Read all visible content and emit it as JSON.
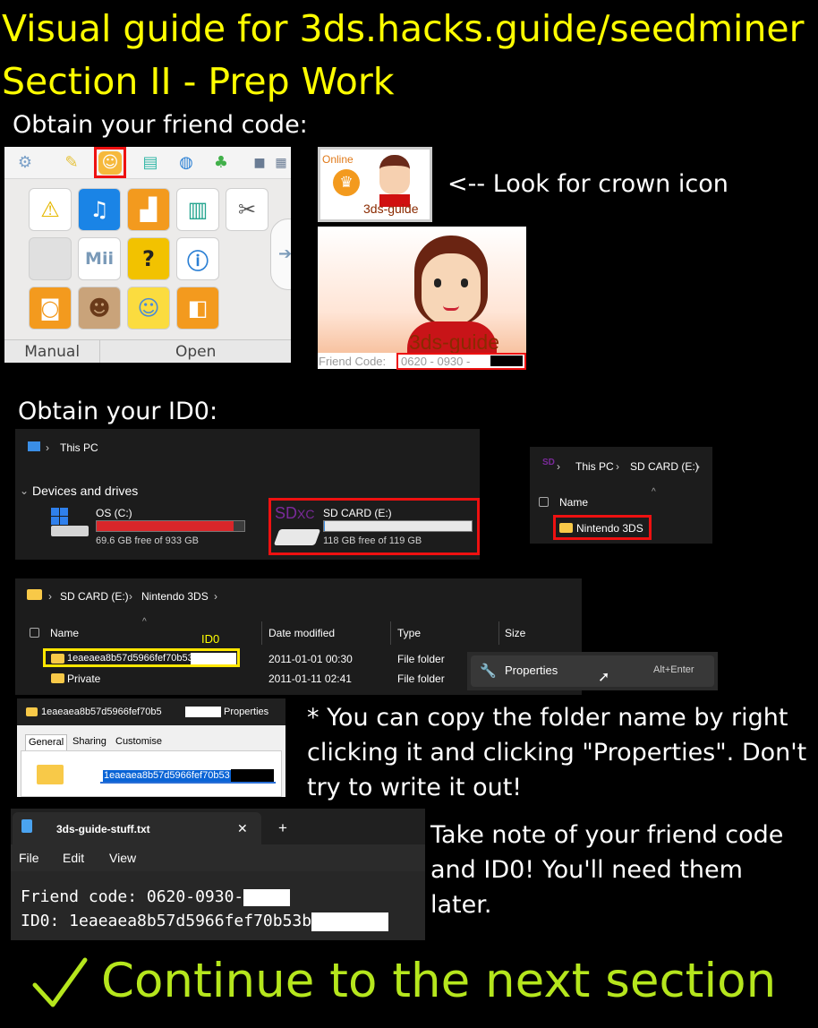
{
  "title_line1": "Visual guide for 3ds.hacks.guide/seedminer",
  "title_line2": "Section II - Prep Work",
  "step1_heading": "Obtain your friend  code:",
  "home_menu": {
    "manual": "Manual",
    "open": "Open",
    "mii_tile_text": "Mii"
  },
  "mii_small": {
    "status": "Online",
    "name": "3ds-guide"
  },
  "crown_hint": "<-- Look for crown icon",
  "mii_big": {
    "name": "3ds-guide",
    "fc_label": "Friend Code:",
    "fc_value": "0620 - 0930 -"
  },
  "step2_heading": "Obtain your ID0:",
  "explorer1": {
    "path": "This PC",
    "section": "Devices and drives",
    "drive_c": {
      "name": "OS (C:)",
      "free": "69.6 GB free of 933 GB",
      "used_fraction": 0.925
    },
    "drive_e": {
      "name": "SD CARD (E:)",
      "free": "118 GB free of 119 GB",
      "used_fraction": 0.008,
      "logo": "SD",
      "logo_sub": "XC"
    }
  },
  "explorer2": {
    "path1": "This PC",
    "path2": "SD CARD (E:)",
    "col_name": "Name",
    "folder": "Nintendo 3DS",
    "icon_text": "SD"
  },
  "explorer3": {
    "path1": "SD CARD (E:)",
    "path2": "Nintendo 3DS",
    "columns": [
      "Name",
      "Date modified",
      "Type",
      "Size"
    ],
    "id0_tag": "ID0",
    "rows": [
      {
        "name": "1eaeaea8b57d5966fef70b53",
        "date": "2011-01-01 00:30",
        "type": "File folder"
      },
      {
        "name": "Private",
        "date": "2011-01-11 02:41",
        "type": "File folder"
      }
    ]
  },
  "context_menu": {
    "label": "Properties",
    "shortcut": "Alt+Enter"
  },
  "props": {
    "title_prefix": "1eaeaea8b57d5966fef70b5",
    "title_suffix": "Properties",
    "tabs": [
      "General",
      "Sharing",
      "Customise"
    ],
    "field": "1eaeaea8b57d5966fef70b53"
  },
  "copy_note": "* You can copy the folder name by right clicking it and clicking \"Properties\". Don't try to write it out!",
  "notepad": {
    "tab": "3ds-guide-stuff.txt",
    "close": "✕",
    "plus": "+",
    "menu": [
      "File",
      "Edit",
      "View"
    ],
    "line1": "Friend code: 0620-0930-",
    "line2": "ID0: 1eaeaea8b57d5966fef70b53b"
  },
  "take_note": "Take note of your friend code and ID0! You'll need them later.",
  "continue": "Continue to the next section",
  "colors": {
    "yellow": "#ffff00",
    "green": "#b5e61d",
    "red": "#e11111"
  }
}
